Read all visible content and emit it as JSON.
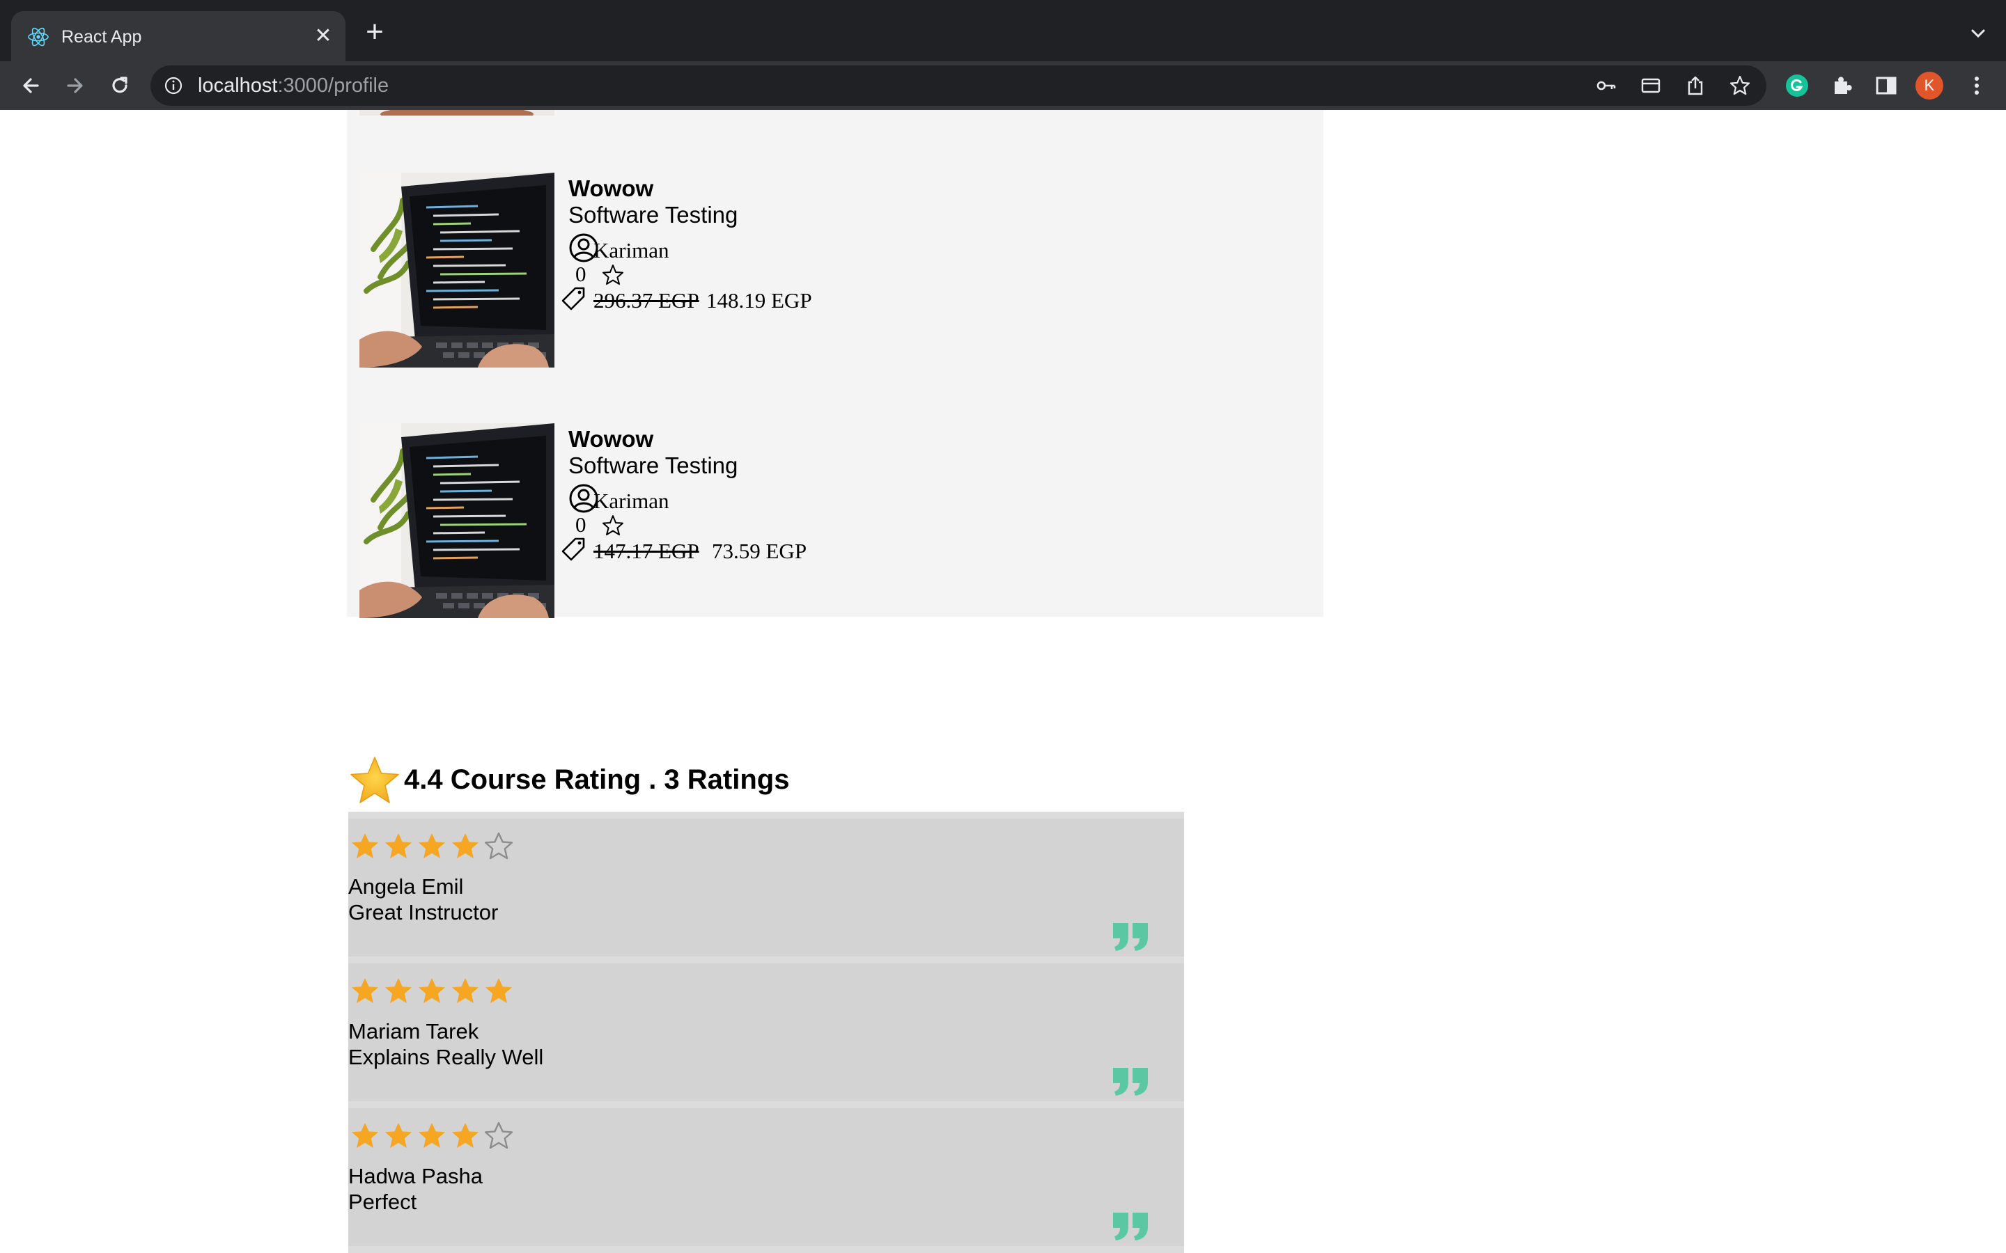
{
  "browser": {
    "tab_title": "React App",
    "url_host": "localhost",
    "url_path": ":3000/profile",
    "profile_initial": "K",
    "icons": {
      "favicon": "react-logo-icon",
      "close": "close-icon",
      "new_tab": "plus-icon",
      "tab_search": "chevron-down-icon",
      "back": "arrow-left-icon",
      "forward": "arrow-right-icon",
      "reload": "reload-icon",
      "site_info": "info-icon",
      "passwords": "key-icon",
      "payment": "card-icon",
      "share": "share-icon",
      "bookmark": "star-outline-icon",
      "grammarly": "grammarly-icon",
      "extensions": "puzzle-icon",
      "side_panel": "side-panel-icon",
      "menu": "kebab-menu-icon"
    }
  },
  "courses": [
    {
      "title": "Wowow",
      "category": "Software Testing",
      "instructor": "Kariman",
      "rating": "0",
      "old_price": "296.37 EGP",
      "new_price": "148.19 EGP"
    },
    {
      "title": "Wowow",
      "category": "Software Testing",
      "instructor": "Kariman",
      "rating": "0",
      "old_price": "147.17 EGP",
      "new_price": "73.59 EGP"
    }
  ],
  "rating_summary": {
    "text": "4.4 Course Rating . 3 Ratings",
    "average": 4.4,
    "count": 3
  },
  "reviews": [
    {
      "stars": 4,
      "max_stars": 5,
      "name": "Angela Emil",
      "comment": "Great Instructor"
    },
    {
      "stars": 5,
      "max_stars": 5,
      "name": "Mariam Tarek",
      "comment": "Explains Really Well"
    },
    {
      "stars": 4,
      "max_stars": 5,
      "name": "Hadwa Pasha",
      "comment": "Perfect"
    }
  ],
  "colors": {
    "star_filled": "#f5a623",
    "star_empty": "#8c8c8c",
    "quote": "#5cc8a3",
    "card_bg": "#f4f4f4",
    "review_bg": "#d3d3d3"
  }
}
